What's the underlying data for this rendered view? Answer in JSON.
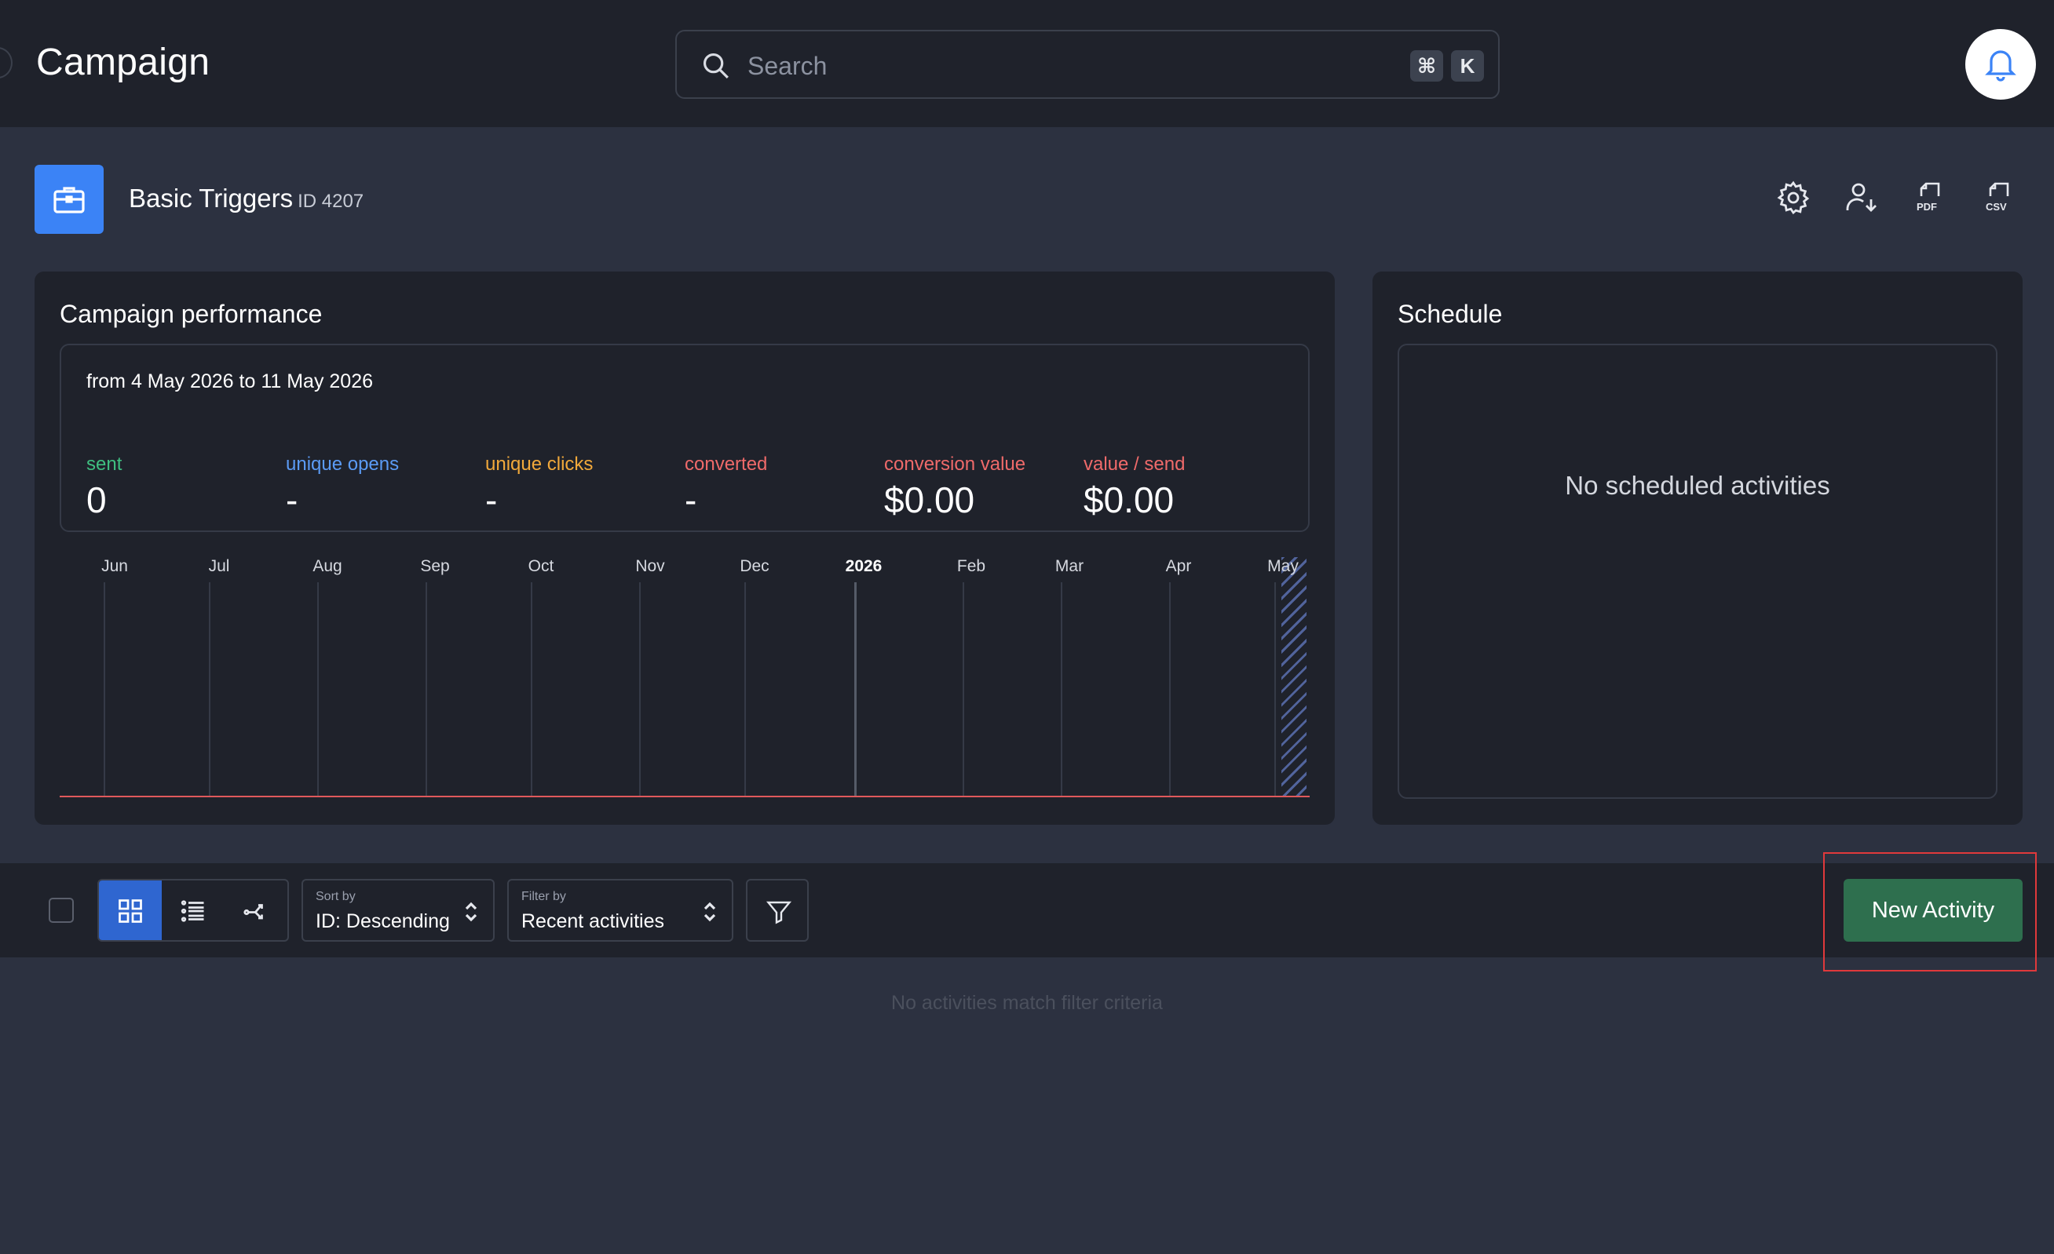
{
  "header": {
    "title": "Campaign",
    "search_placeholder": "Search",
    "shortcut_keys": [
      "⌘",
      "K"
    ]
  },
  "campaign": {
    "name": "Basic Triggers",
    "id_label": "ID 4207",
    "icon": "briefcase-icon",
    "actions": [
      "settings-icon",
      "user-download-icon",
      "pdf-export-icon",
      "csv-export-icon"
    ]
  },
  "performance": {
    "title": "Campaign performance",
    "range": "from 4 May 2026 to 11 May 2026",
    "stats": [
      {
        "label": "sent",
        "value": "0",
        "color": "#3fbf80"
      },
      {
        "label": "unique opens",
        "value": "-",
        "color": "#5b9bf5"
      },
      {
        "label": "unique clicks",
        "value": "-",
        "color": "#f2a93b"
      },
      {
        "label": "converted",
        "value": "-",
        "color": "#ef6a6a"
      },
      {
        "label": "conversion value",
        "value": "$0.00",
        "color": "#ef6a6a"
      },
      {
        "label": "value / send",
        "value": "$0.00",
        "color": "#ef6a6a"
      }
    ],
    "timeline": [
      "Jun",
      "Jul",
      "Aug",
      "Sep",
      "Oct",
      "Nov",
      "Dec",
      "2026",
      "Feb",
      "Mar",
      "Apr",
      "May"
    ]
  },
  "schedule": {
    "title": "Schedule",
    "empty_text": "No scheduled activities"
  },
  "toolbar": {
    "sort_small": "Sort by",
    "sort_value": "ID: Descending",
    "filter_small": "Filter by",
    "filter_value": "Recent activities",
    "new_activity": "New Activity"
  },
  "activities": {
    "empty_text": "No activities match filter criteria"
  },
  "colors": {
    "accent_blue": "#3b83f6",
    "new_button": "#2e6f4e",
    "baseline": "#e0595b"
  }
}
